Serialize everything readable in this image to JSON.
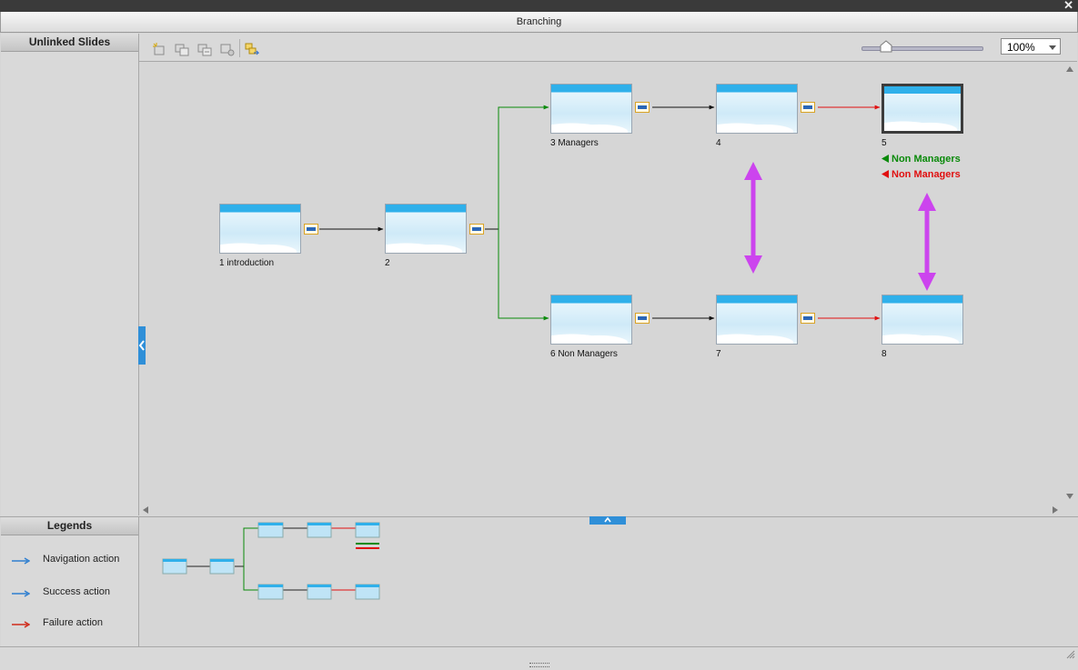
{
  "window": {
    "title": "Branching",
    "close_glyph": "✕"
  },
  "left_panel": {
    "title": "Unlinked Slides"
  },
  "legends": {
    "title": "Legends",
    "items": [
      {
        "label": "Navigation action",
        "color": "#2f7fd0"
      },
      {
        "label": "Success action",
        "color": "#2f7fd0"
      },
      {
        "label": "Failure action",
        "color": "#d02a1a"
      }
    ]
  },
  "toolbar": {
    "icons": [
      "new-branch-icon",
      "group-slides-icon",
      "ungroup-slides-icon",
      "remove-group-icon",
      "export-icon"
    ],
    "zoom_value": "100%",
    "zoom_slider_percent": 20
  },
  "slides": [
    {
      "label": "1  introduction"
    },
    {
      "label": "2"
    },
    {
      "label": "3  Managers"
    },
    {
      "label": "4"
    },
    {
      "label": "5"
    },
    {
      "label": "6  Non Managers"
    },
    {
      "label": "7"
    },
    {
      "label": "8"
    }
  ],
  "branch_labels": [
    {
      "text": "Non Managers",
      "color": "#0a8a0a"
    },
    {
      "text": "Non Managers",
      "color": "#e01010"
    }
  ],
  "colors": {
    "success": "#0a8a0a",
    "failure": "#e01010",
    "navigation": "#111111",
    "highlight": "#cc44ee",
    "accent": "#2f8fd8"
  }
}
